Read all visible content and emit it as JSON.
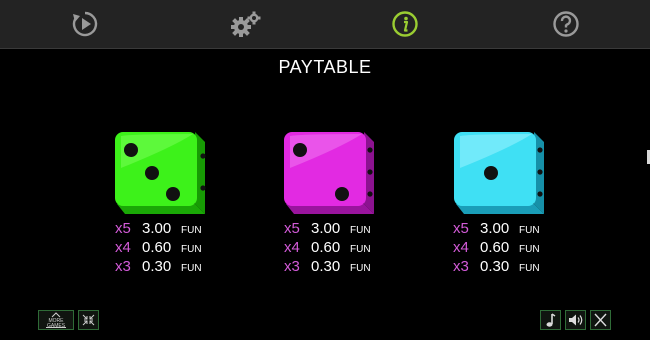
{
  "toolbar": {
    "icons": [
      "replay-icon",
      "settings-gears-icon",
      "info-icon",
      "help-icon"
    ],
    "active_color": "#9acd32",
    "icon_color": "#9a9a9a"
  },
  "title": "PAYTABLE",
  "symbols": [
    {
      "name": "green-die",
      "color": "#33ee11",
      "pips": 3,
      "payouts": [
        {
          "mult": "x5",
          "amount": "3.00",
          "currency": "FUN"
        },
        {
          "mult": "x4",
          "amount": "0.60",
          "currency": "FUN"
        },
        {
          "mult": "x3",
          "amount": "0.30",
          "currency": "FUN"
        }
      ]
    },
    {
      "name": "magenta-die",
      "color": "#dd22dd",
      "pips": 2,
      "payouts": [
        {
          "mult": "x5",
          "amount": "3.00",
          "currency": "FUN"
        },
        {
          "mult": "x4",
          "amount": "0.60",
          "currency": "FUN"
        },
        {
          "mult": "x3",
          "amount": "0.30",
          "currency": "FUN"
        }
      ]
    },
    {
      "name": "cyan-die",
      "color": "#33ddee",
      "pips": 1,
      "payouts": [
        {
          "mult": "x5",
          "amount": "3.00",
          "currency": "FUN"
        },
        {
          "mult": "x4",
          "amount": "0.60",
          "currency": "FUN"
        },
        {
          "mult": "x3",
          "amount": "0.30",
          "currency": "FUN"
        }
      ]
    }
  ],
  "bottom": {
    "more_games_label": "MORE GAMES",
    "left_icons": [
      "more-games-icon",
      "collapse-icon"
    ],
    "right_icons": [
      "music-note-icon",
      "speaker-icon",
      "close-icon"
    ],
    "button_border_color": "#2f6b37"
  }
}
